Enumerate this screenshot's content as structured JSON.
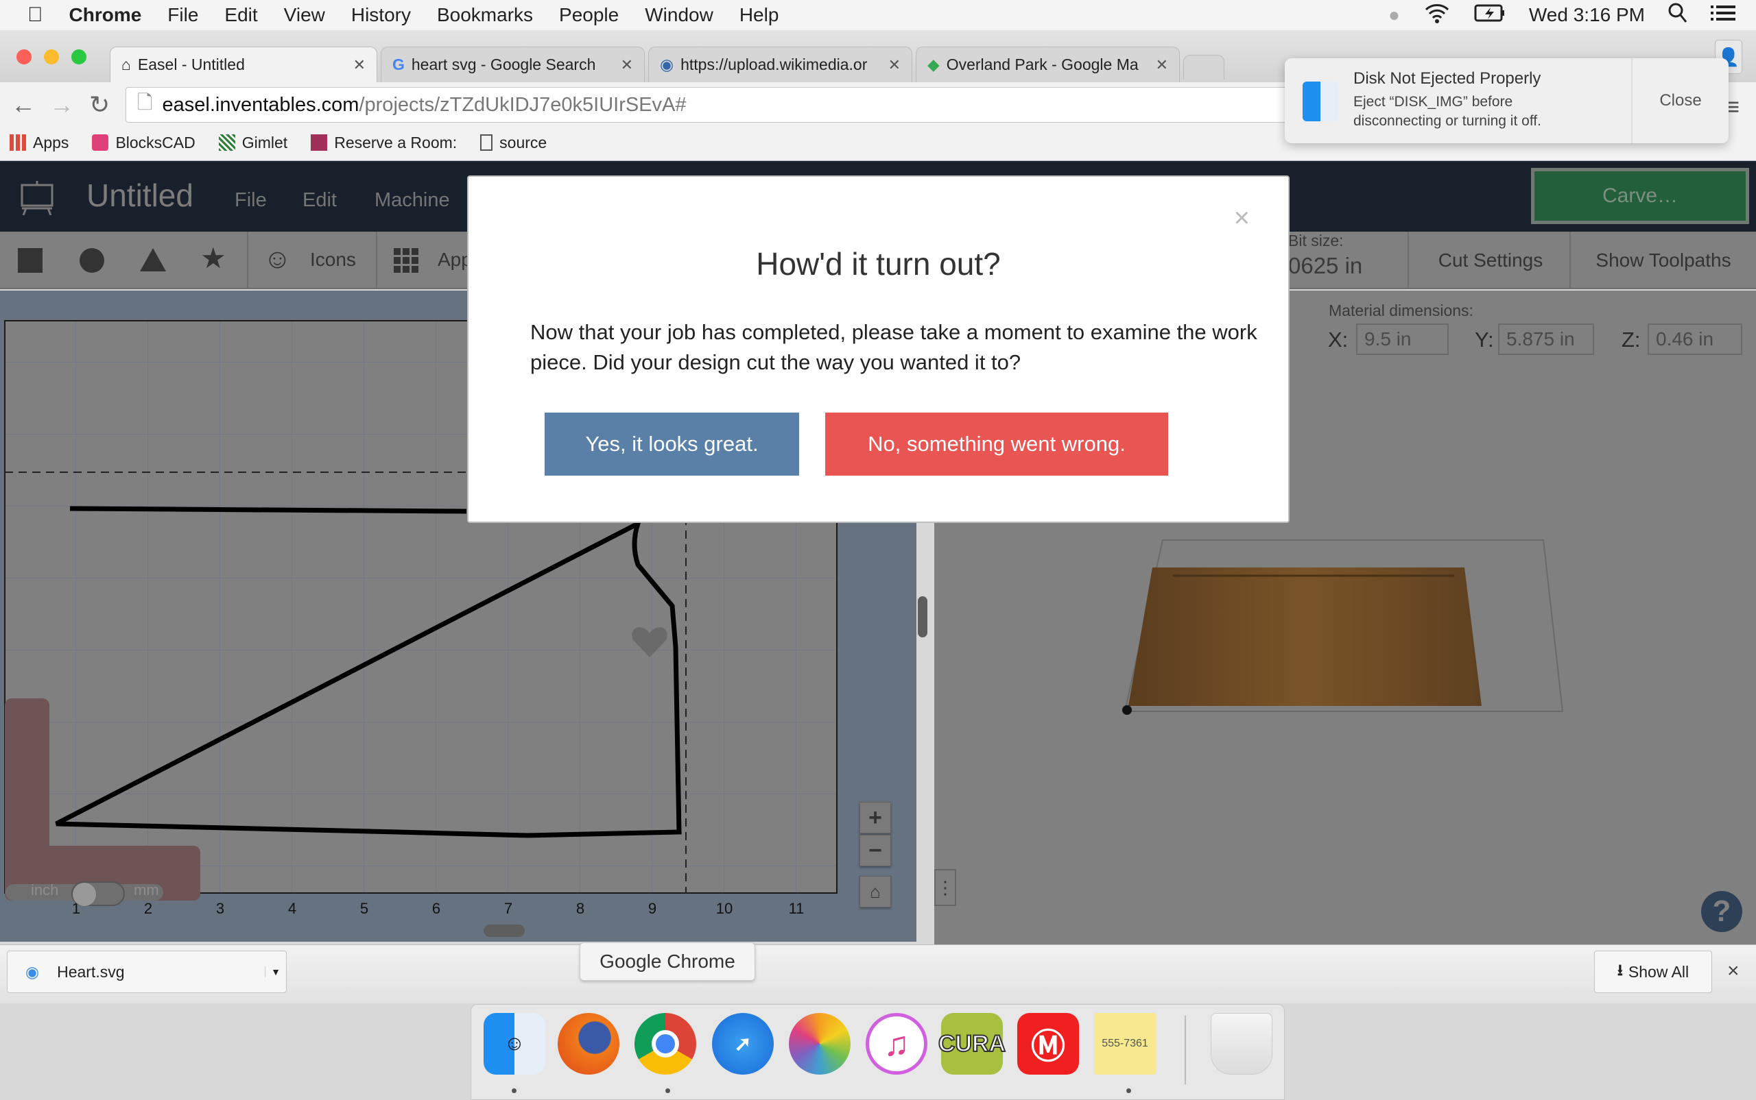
{
  "menubar": {
    "items": [
      "Chrome",
      "File",
      "Edit",
      "View",
      "History",
      "Bookmarks",
      "People",
      "Window",
      "Help"
    ],
    "clock": "Wed 3:16 PM"
  },
  "tabs": [
    {
      "title": "Easel - Untitled",
      "icon": "easel-icon",
      "active": true
    },
    {
      "title": "heart svg - Google Search",
      "icon": "google-icon"
    },
    {
      "title": "https://upload.wikimedia.or",
      "icon": "wikimedia-icon"
    },
    {
      "title": "Overland Park - Google Ma",
      "icon": "google-maps-icon"
    }
  ],
  "omnibox": {
    "host": "easel.inventables.com",
    "path": "/projects/zTZdUkIDJ7e0k5IUIrSEvA#"
  },
  "bookmarks": [
    {
      "label": "Apps",
      "color": "#e04a3a"
    },
    {
      "label": "BlocksCAD",
      "color": "#e0407a"
    },
    {
      "label": "Gimlet",
      "color": "#2f7d3a"
    },
    {
      "label": "Reserve a Room:",
      "color": "#a0305a"
    },
    {
      "label": "source",
      "color": "#ffffff"
    }
  ],
  "notification": {
    "title": "Disk Not Ejected Properly",
    "line1": "Eject “DISK_IMG” before",
    "line2": "disconnecting or turning it off.",
    "close": "Close"
  },
  "app": {
    "title": "Untitled",
    "menu": [
      "File",
      "Edit",
      "Machine"
    ],
    "carve": "Carve…",
    "icons_label": "Icons",
    "apps_label": "App",
    "bit_label": "Bit size:",
    "bit_value": "0625 in",
    "cut_settings": "Cut Settings",
    "show_toolpaths": "Show Toolpaths",
    "material_label": "Material dimensions:",
    "x_label": "X:",
    "x_value": "9.5 in",
    "y_label": "Y:",
    "y_value": "5.875 in",
    "z_label": "Z:",
    "z_value": "0.46 in",
    "unit_inch": "inch",
    "unit_mm": "mm",
    "ruler": [
      "1",
      "2",
      "3",
      "4",
      "5",
      "6",
      "7",
      "8",
      "9",
      "10",
      "11"
    ],
    "help": "?"
  },
  "modal": {
    "title": "How'd it turn out?",
    "body": "Now that your job has completed, please take a moment to examine the work piece. Did your design cut the way you wanted it to?",
    "yes": "Yes, it looks great.",
    "no": "No, something went wrong.",
    "close": "×",
    "yes_color": "#5a80a7",
    "no_color": "#e85552"
  },
  "downloads": {
    "file": "Heart.svg",
    "show_all": "Show All",
    "close": "×"
  },
  "tooltip": "Google Chrome",
  "dock": [
    {
      "name": "Finder",
      "running": true
    },
    {
      "name": "Firefox"
    },
    {
      "name": "Chrome",
      "running": true
    },
    {
      "name": "Safari"
    },
    {
      "name": "Photos"
    },
    {
      "name": "iTunes"
    },
    {
      "name": "CURA"
    },
    {
      "name": "MakerBot"
    },
    {
      "name": "Stickies",
      "running": true
    },
    {
      "name": "Trash"
    }
  ]
}
